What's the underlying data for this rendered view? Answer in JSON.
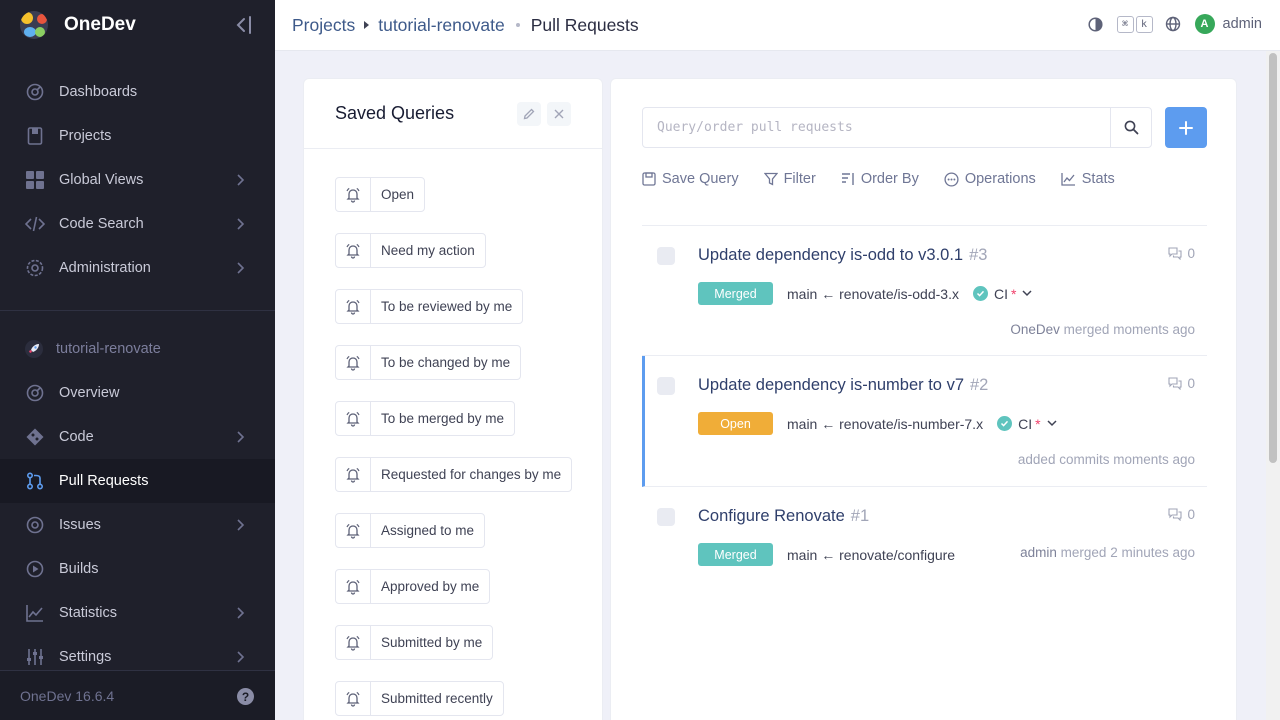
{
  "app": {
    "name": "OneDev",
    "version": "OneDev 16.6.4"
  },
  "sidebar": {
    "global_items": [
      {
        "label": "Dashboards",
        "icon": "dashboard-icon"
      },
      {
        "label": "Projects",
        "icon": "projects-icon"
      },
      {
        "label": "Global Views",
        "icon": "grid-icon"
      },
      {
        "label": "Code Search",
        "icon": "code-icon"
      },
      {
        "label": "Administration",
        "icon": "gear-icon"
      }
    ],
    "project_name": "tutorial-renovate",
    "project_items": [
      {
        "label": "Overview",
        "icon": "overview-icon"
      },
      {
        "label": "Code",
        "icon": "git-icon"
      },
      {
        "label": "Pull Requests",
        "icon": "pull-request-icon"
      },
      {
        "label": "Issues",
        "icon": "issue-icon"
      },
      {
        "label": "Builds",
        "icon": "play-icon"
      },
      {
        "label": "Statistics",
        "icon": "chart-icon"
      },
      {
        "label": "Settings",
        "icon": "sliders-icon"
      }
    ]
  },
  "breadcrumb": {
    "root": "Projects",
    "project": "tutorial-renovate",
    "page": "Pull Requests"
  },
  "topbar": {
    "kbd_cmd": "⌘",
    "kbd_k": "k",
    "avatar_letter": "A",
    "user": "admin"
  },
  "saved_queries": {
    "title": "Saved Queries",
    "items": [
      "Open",
      "Need my action",
      "To be reviewed by me",
      "To be changed by me",
      "To be merged by me",
      "Requested for changes by me",
      "Assigned to me",
      "Approved by me",
      "Submitted by me",
      "Submitted recently"
    ]
  },
  "pull_requests": {
    "search_placeholder": "Query/order pull requests",
    "toolbar": {
      "save_query": "Save Query",
      "filter": "Filter",
      "order_by": "Order By",
      "operations": "Operations",
      "stats": "Stats"
    },
    "items": [
      {
        "title": "Update dependency is-odd to v3.0.1",
        "number": "#3",
        "comments": "0",
        "status": "Merged",
        "branches": "main ← renovate/is-odd-3.x",
        "ci": "CI",
        "actor": "OneDev",
        "action": "merged moments ago"
      },
      {
        "title": "Update dependency is-number to v7",
        "number": "#2",
        "comments": "0",
        "status": "Open",
        "branches": "main ← renovate/is-number-7.x",
        "ci": "CI",
        "actor": "",
        "action": "added commits moments ago"
      },
      {
        "title": "Configure Renovate",
        "number": "#1",
        "comments": "0",
        "status": "Merged",
        "branches": "main ← renovate/configure",
        "ci": "",
        "actor": "admin",
        "action": "merged 2 minutes ago"
      }
    ]
  },
  "colors": {
    "sidebar_bg": "#1f202b",
    "accent_blue": "#5d9cef",
    "merged": "#5fc4be",
    "open": "#f0ad38"
  }
}
